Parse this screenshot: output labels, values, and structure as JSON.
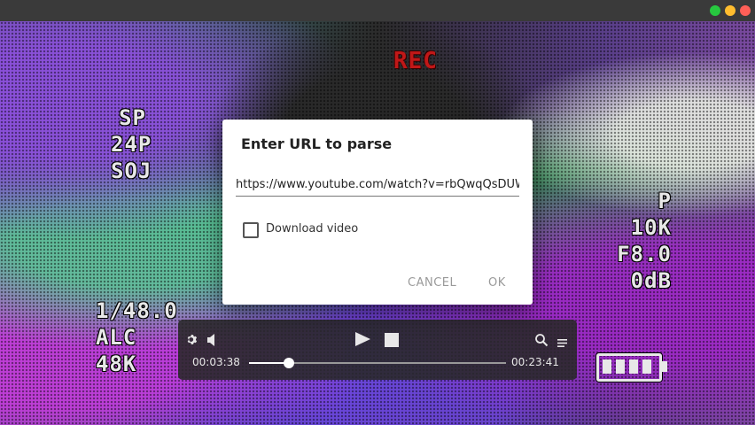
{
  "window": {
    "buttons": [
      "maximize",
      "minimize",
      "close"
    ]
  },
  "video_overlay": {
    "rec": "REC",
    "left_top": [
      "SP",
      "24P",
      "SOJ"
    ],
    "right_mid": [
      "P 10K",
      "F8.0",
      "0dB"
    ],
    "left_bot": [
      "1/48.0",
      "ALC",
      "48K"
    ],
    "battery_icon": "battery-icon"
  },
  "dialog": {
    "title": "Enter URL to parse",
    "url_value": "https://www.youtube.com/watch?v=rbQwqQsDUW",
    "checkbox_label": "Download video",
    "checkbox_checked": false,
    "cancel_label": "CANCEL",
    "ok_label": "OK"
  },
  "player": {
    "current_time": "00:03:38",
    "duration": "00:23:41",
    "progress": 0.1535,
    "icons": [
      "gear-icon",
      "volume-icon",
      "play-icon",
      "stop-icon",
      "search-icon",
      "menu-icon"
    ]
  },
  "colors": {
    "rec": "#c01818",
    "dialog_bg": "#ffffff",
    "controls_bg": "#282828",
    "disabled_text": "#9a9a9a"
  }
}
